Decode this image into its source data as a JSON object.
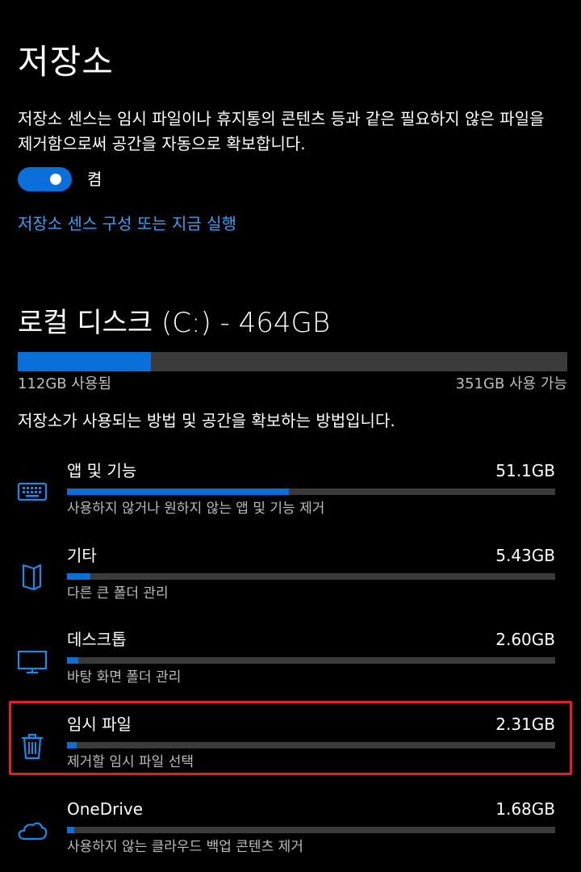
{
  "header": {
    "title": "저장소",
    "description": "저장소 센스는 임시 파일이나 휴지통의 콘텐츠 등과 같은 필요하지 않은 파일을 제거함으로써 공간을 자동으로 확보합니다.",
    "toggle_state_label": "켬",
    "toggle_on": true,
    "configure_link": "저장소 센스 구성 또는 지금 실행"
  },
  "disk": {
    "title": "로컬 디스크 (C:) - 464GB",
    "used_label": "112GB 사용됨",
    "free_label": "351GB 사용 가능",
    "used_fraction": 0.242,
    "usage_description": "저장소가 사용되는 방법 및 공간을 확보하는 방법입니다."
  },
  "categories": [
    {
      "name": "앱 및 기능",
      "size": "51.1GB",
      "subtitle": "사용하지 않거나 원하지 않는 앱 및 기능 제거",
      "icon": "keyboard-icon",
      "fraction": 0.454
    },
    {
      "name": "기타",
      "size": "5.43GB",
      "subtitle": "다른 큰 폴더 관리",
      "icon": "document-icon",
      "fraction": 0.048
    },
    {
      "name": "데스크톱",
      "size": "2.60GB",
      "subtitle": "바탕 화면 폴더 관리",
      "icon": "monitor-icon",
      "fraction": 0.023
    },
    {
      "name": "임시 파일",
      "size": "2.31GB",
      "subtitle": "제거할 임시 파일 선택",
      "icon": "trash-icon",
      "fraction": 0.02
    },
    {
      "name": "OneDrive",
      "size": "1.68GB",
      "subtitle": "사용하지 않는 클라우드 백업 콘텐츠 제거",
      "icon": "cloud-icon",
      "fraction": 0.015
    }
  ],
  "colors": {
    "accent": "#0a6fd8",
    "link": "#3a9ff0",
    "highlight": "#e02027",
    "track": "#3b3b3b"
  }
}
